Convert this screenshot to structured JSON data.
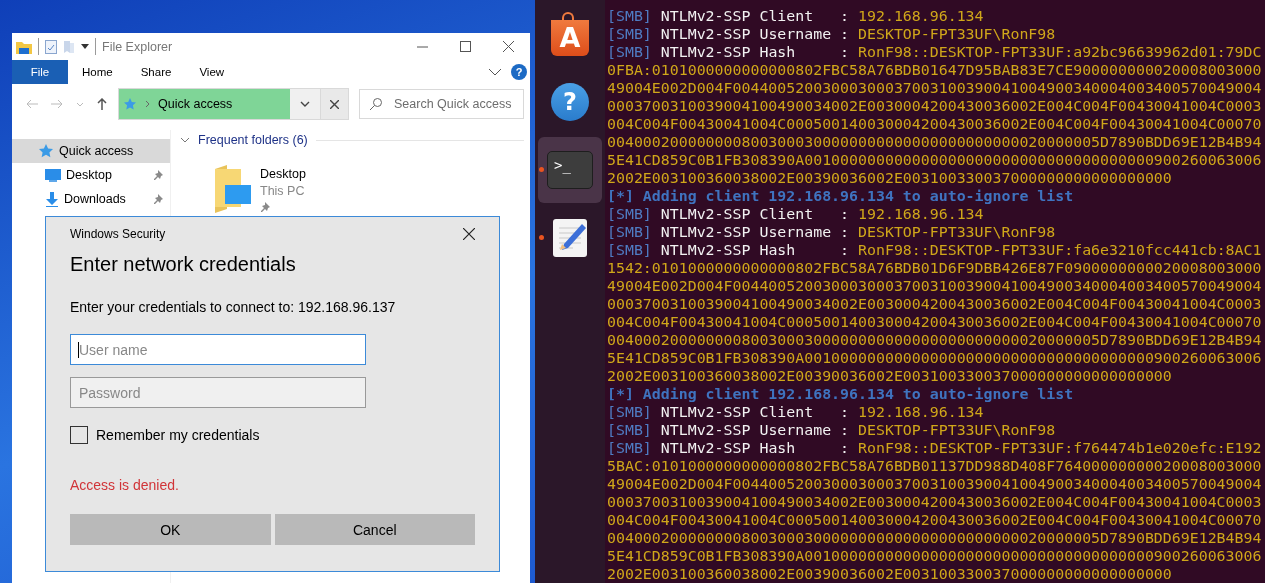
{
  "explorer": {
    "title": "File Explorer",
    "ribbon": [
      {
        "label": "File",
        "kind": "menu"
      },
      {
        "label": "Home",
        "kind": "tab"
      },
      {
        "label": "Share",
        "kind": "tab"
      },
      {
        "label": "View",
        "kind": "tab"
      }
    ],
    "help_button": "?",
    "address": "Quick access",
    "search": {
      "placeholder": "Search Quick access"
    },
    "nav_items": [
      {
        "label": "Quick access",
        "kind": "star",
        "selected": true,
        "pinned": false,
        "children": [
          {
            "label": "Desktop",
            "kind": "desktop",
            "selected": false,
            "pinned": true
          },
          {
            "label": "Downloads",
            "kind": "download",
            "selected": false,
            "pinned": true
          }
        ]
      }
    ],
    "group": {
      "label": "Frequent folders (6)",
      "expanded": true
    },
    "folders": [
      {
        "name": "Desktop",
        "location": "This PC",
        "pinned": true
      }
    ]
  },
  "dialog": {
    "title": "Windows Security",
    "heading": "Enter network credentials",
    "prompt": "Enter your credentials to connect to: 192.168.96.137",
    "username": {
      "placeholder": "User name",
      "focused": true
    },
    "password": {
      "placeholder": "Password",
      "focused": false
    },
    "remember": {
      "label": "Remember my credentials",
      "checked": false
    },
    "error": "Access is denied.",
    "buttons": [
      "OK",
      "Cancel"
    ]
  },
  "dock": [
    {
      "kind": "store",
      "glyph": "A",
      "selected": false,
      "running": false
    },
    {
      "kind": "help",
      "glyph": "?",
      "selected": false,
      "running": false
    },
    {
      "kind": "terminal",
      "glyph": ">_",
      "selected": true,
      "running": true
    },
    {
      "kind": "editor",
      "selected": false,
      "running": true
    }
  ],
  "terminal": {
    "lines": [
      {
        "kind": "smb",
        "tag": "[SMB]",
        "label": "NTLMv2-SSP Client   :",
        "value": "192.168.96.134"
      },
      {
        "kind": "smb",
        "tag": "[SMB]",
        "label": "NTLMv2-SSP Username :",
        "value": "DESKTOP-FPT33UF\\RonF98"
      },
      {
        "kind": "smb",
        "tag": "[SMB]",
        "label": "NTLMv2-SSP Hash     :",
        "value": "RonF98::DESKTOP-FPT33UF:a92bc96639962d01:79DC"
      },
      {
        "kind": "data",
        "text": "0FBA:0101000000000000802FBC58A76BDB01647D95BAB83E7CE900000000020008003000"
      },
      {
        "kind": "data",
        "text": "49004E002D004F00440052003000300037003100390041004900340004003400570049004"
      },
      {
        "kind": "data",
        "text": "0003700310039004100490034002E0030004200430036002E004C004F00430041004C0003"
      },
      {
        "kind": "data",
        "text": "004C004F00430041004C000500140030004200430036002E004C004F00430041004C00070"
      },
      {
        "kind": "data",
        "text": "0040002000000008003000300000000000000000000000020000005D7890BDD69E12B4B94"
      },
      {
        "kind": "data",
        "text": "5E41CD859C0B1FB308390A001000000000000000000000000000000000000900260063006"
      },
      {
        "kind": "data",
        "text": "2002E003100360038002E00390036002E003100330037000000000000000000"
      },
      {
        "kind": "info",
        "text": "[*] Adding client 192.168.96.134 to auto-ignore list"
      },
      {
        "kind": "smb",
        "tag": "[SMB]",
        "label": "NTLMv2-SSP Client   :",
        "value": "192.168.96.134"
      },
      {
        "kind": "smb",
        "tag": "[SMB]",
        "label": "NTLMv2-SSP Username :",
        "value": "DESKTOP-FPT33UF\\RonF98"
      },
      {
        "kind": "smb",
        "tag": "[SMB]",
        "label": "NTLMv2-SSP Hash     :",
        "value": "RonF98::DESKTOP-FPT33UF:fa6e3210fcc441cb:8AC1"
      },
      {
        "kind": "data",
        "text": "1542:0101000000000000802FBC58A76BDB01D6F9DBB426E87F0900000000020008003000"
      },
      {
        "kind": "data",
        "text": "49004E002D004F00440052003000300037003100390041004900340004003400570049004"
      },
      {
        "kind": "data",
        "text": "0003700310039004100490034002E0030004200430036002E004C004F00430041004C0003"
      },
      {
        "kind": "data",
        "text": "004C004F00430041004C000500140030004200430036002E004C004F00430041004C00070"
      },
      {
        "kind": "data",
        "text": "0040002000000008003000300000000000000000000000020000005D7890BDD69E12B4B94"
      },
      {
        "kind": "data",
        "text": "5E41CD859C0B1FB308390A001000000000000000000000000000000000000900260063006"
      },
      {
        "kind": "data",
        "text": "2002E003100360038002E00390036002E003100330037000000000000000000"
      },
      {
        "kind": "info",
        "text": "[*] Adding client 192.168.96.134 to auto-ignore list"
      },
      {
        "kind": "smb",
        "tag": "[SMB]",
        "label": "NTLMv2-SSP Client   :",
        "value": "192.168.96.134"
      },
      {
        "kind": "smb",
        "tag": "[SMB]",
        "label": "NTLMv2-SSP Username :",
        "value": "DESKTOP-FPT33UF\\RonF98"
      },
      {
        "kind": "smb",
        "tag": "[SMB]",
        "label": "NTLMv2-SSP Hash     :",
        "value": "RonF98::DESKTOP-FPT33UF:f764474b1e020efc:E192"
      },
      {
        "kind": "data",
        "text": "5BAC:0101000000000000802FBC58A76BDB01137DD988D408F76400000000020008003000"
      },
      {
        "kind": "data",
        "text": "49004E002D004F00440052003000300037003100390041004900340004003400570049004"
      },
      {
        "kind": "data",
        "text": "0003700310039004100490034002E0030004200430036002E004C004F00430041004C0003"
      },
      {
        "kind": "data",
        "text": "004C004F00430041004C000500140030004200430036002E004C004F00430041004C00070"
      },
      {
        "kind": "data",
        "text": "0040002000000008003000300000000000000000000000020000005D7890BDD69E12B4B94"
      },
      {
        "kind": "data",
        "text": "5E41CD859C0B1FB308390A001000000000000000000000000000000000000900260063006"
      },
      {
        "kind": "data",
        "text": "2002E003100360038002E00390036002E003100330037000000000000000000"
      }
    ]
  }
}
